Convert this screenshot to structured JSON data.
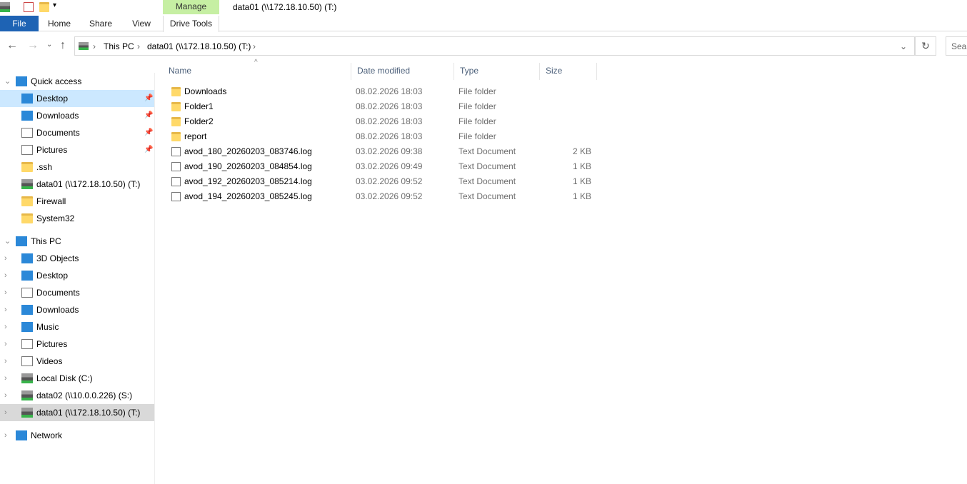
{
  "window": {
    "title": "data01 (\\\\172.18.10.50) (T:)"
  },
  "ribbon": {
    "manage": "Manage",
    "tabs": [
      "File",
      "Home",
      "Share",
      "View",
      "Drive Tools"
    ]
  },
  "address": {
    "parts": [
      "This PC",
      "data01 (\\\\172.18.10.50) (T:)"
    ],
    "search_placeholder": "Sear"
  },
  "sidebar": [
    {
      "label": "Quick access",
      "icon": "star-icon",
      "level": 0,
      "chev": "v"
    },
    {
      "label": "Desktop",
      "icon": "desktop-icon",
      "level": 1,
      "pin": true,
      "selected": "light"
    },
    {
      "label": "Downloads",
      "icon": "download-icon",
      "level": 1,
      "pin": true
    },
    {
      "label": "Documents",
      "icon": "documents-icon",
      "level": 1,
      "pin": true
    },
    {
      "label": "Pictures",
      "icon": "pictures-icon",
      "level": 1,
      "pin": true
    },
    {
      "label": ".ssh",
      "icon": "folder-icon",
      "level": 1
    },
    {
      "label": "data01 (\\\\172.18.10.50) (T:)",
      "icon": "network-drive-icon",
      "level": 1
    },
    {
      "label": "Firewall",
      "icon": "folder-icon",
      "level": 1
    },
    {
      "label": "System32",
      "icon": "folder-icon",
      "level": 1
    },
    {
      "label": "This PC",
      "icon": "pc-icon",
      "level": 0,
      "chev": "v"
    },
    {
      "label": "3D Objects",
      "icon": "3d-objects-icon",
      "level": 1,
      "chev": ">"
    },
    {
      "label": "Desktop",
      "icon": "desktop-icon",
      "level": 1,
      "chev": ">"
    },
    {
      "label": "Documents",
      "icon": "documents-icon",
      "level": 1,
      "chev": ">"
    },
    {
      "label": "Downloads",
      "icon": "download-icon",
      "level": 1,
      "chev": ">"
    },
    {
      "label": "Music",
      "icon": "music-icon",
      "level": 1,
      "chev": ">"
    },
    {
      "label": "Pictures",
      "icon": "pictures-icon",
      "level": 1,
      "chev": ">"
    },
    {
      "label": "Videos",
      "icon": "videos-icon",
      "level": 1,
      "chev": ">"
    },
    {
      "label": "Local Disk (C:)",
      "icon": "local-disk-icon",
      "level": 1,
      "chev": ">"
    },
    {
      "label": "data02 (\\\\10.0.0.226) (S:)",
      "icon": "disconnected-drive-icon",
      "level": 1,
      "chev": ">"
    },
    {
      "label": "data01 (\\\\172.18.10.50) (T:)",
      "icon": "network-drive-icon",
      "level": 1,
      "chev": ">",
      "selected": "gray"
    },
    {
      "label": "Network",
      "icon": "network-icon",
      "level": 0,
      "chev": ">"
    }
  ],
  "columns": [
    "Name",
    "Date modified",
    "Type",
    "Size"
  ],
  "files": [
    {
      "name": "Downloads",
      "date": "08.02.2026 18:03",
      "type": "File folder",
      "size": "",
      "icon": "folder-icon"
    },
    {
      "name": "Folder1",
      "date": "08.02.2026 18:03",
      "type": "File folder",
      "size": "",
      "icon": "folder-icon"
    },
    {
      "name": "Folder2",
      "date": "08.02.2026 18:03",
      "type": "File folder",
      "size": "",
      "icon": "folder-icon"
    },
    {
      "name": "report",
      "date": "08.02.2026 18:03",
      "type": "File folder",
      "size": "",
      "icon": "folder-icon"
    },
    {
      "name": "avod_180_20260203_083746.log",
      "date": "03.02.2026 09:38",
      "type": "Text Document",
      "size": "2 KB",
      "icon": "text-file-icon"
    },
    {
      "name": "avod_190_20260203_084854.log",
      "date": "03.02.2026 09:49",
      "type": "Text Document",
      "size": "1 KB",
      "icon": "text-file-icon"
    },
    {
      "name": "avod_192_20260203_085214.log",
      "date": "03.02.2026 09:52",
      "type": "Text Document",
      "size": "1 KB",
      "icon": "text-file-icon"
    },
    {
      "name": "avod_194_20260203_085245.log",
      "date": "03.02.2026 09:52",
      "type": "Text Document",
      "size": "1 KB",
      "icon": "text-file-icon"
    }
  ]
}
